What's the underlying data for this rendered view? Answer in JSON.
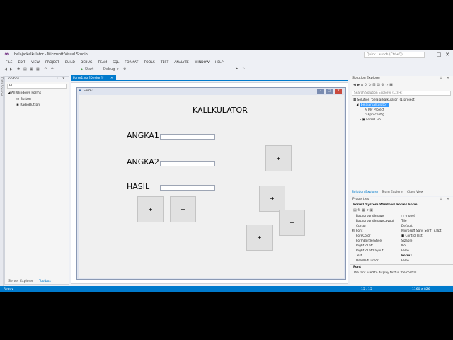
{
  "window": {
    "title": "belajarkalkulator - Microsoft Visual Studio",
    "quick_launch_placeholder": "Quick Launch (Ctrl+Q)"
  },
  "menu": [
    "FILE",
    "EDIT",
    "VIEW",
    "PROJECT",
    "BUILD",
    "DEBUG",
    "TEAM",
    "SQL",
    "FORMAT",
    "TOOLS",
    "TEST",
    "ANALYZE",
    "WINDOW",
    "HELP"
  ],
  "toolbar": {
    "start_label": "Start",
    "config_label": "Debug"
  },
  "left_strip": {
    "label": "Data Sources"
  },
  "toolbox": {
    "title": "Toolbox",
    "search_value": "BU",
    "group": "All Windows Forms",
    "items": [
      "Button",
      "RadioButton"
    ],
    "bottom_tabs": [
      "Server Explorer",
      "Toolbox"
    ]
  },
  "document": {
    "tab_label": "Form1.vb [Design]*",
    "form": {
      "title": "Form1",
      "heading": "KALLKULATOR",
      "labels": [
        "ANGKA1",
        "ANGKA2",
        "HASIL"
      ],
      "button_text": "+"
    }
  },
  "solution_explorer": {
    "title": "Solution Explorer",
    "search_placeholder": "Search Solution Explorer (Ctrl+;)",
    "tree": [
      "Solution 'belajarkalkulator' (1 project)",
      "belajarkalkulator",
      "My Project",
      "App.config",
      "Form1.vb"
    ],
    "tabs": [
      "Solution Explorer",
      "Team Explorer",
      "Class View"
    ]
  },
  "properties": {
    "title": "Properties",
    "object": "Form1  System.Windows.Forms.Form",
    "rows": [
      {
        "name": "BackgroundImage",
        "value": "(none)"
      },
      {
        "name": "BackgroundImageLayout",
        "value": "Tile"
      },
      {
        "name": "Cursor",
        "value": "Default"
      },
      {
        "name": "Font",
        "value": "Microsoft Sans Serif, 7,8pt"
      },
      {
        "name": "ForeColor",
        "value": "ControlText"
      },
      {
        "name": "FormBorderStyle",
        "value": "Sizable"
      },
      {
        "name": "RightToLeft",
        "value": "No"
      },
      {
        "name": "RightToLeftLayout",
        "value": "False"
      },
      {
        "name": "Text",
        "value": "Form1"
      },
      {
        "name": "UseWaitCursor",
        "value": "False"
      }
    ],
    "desc_title": "Font",
    "desc_text": "The font used to display text in the control."
  },
  "status": {
    "text": "Ready",
    "position": "15 , 15",
    "size": "1160 x 826"
  },
  "colors": {
    "accent": "#007acc",
    "selection": "#3399ff",
    "vs_purple": "#68217a"
  }
}
